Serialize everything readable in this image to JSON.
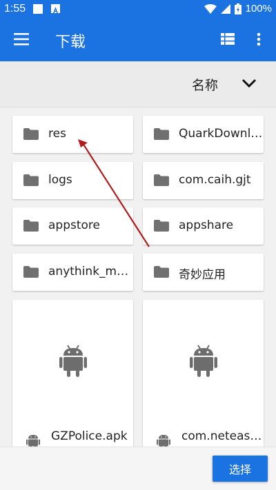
{
  "status_bar": {
    "time": "1:55",
    "battery": "100%"
  },
  "app_bar": {
    "title": "下载"
  },
  "sort": {
    "label": "名称"
  },
  "folders": [
    {
      "name": "res"
    },
    {
      "name": "QuarkDownl…"
    },
    {
      "name": "logs"
    },
    {
      "name": "com.caih.gjt"
    },
    {
      "name": "appstore"
    },
    {
      "name": "appshare"
    },
    {
      "name": "anythink_m…"
    },
    {
      "name": "奇妙应用"
    }
  ],
  "files": [
    {
      "name": "GZPolice.apk"
    },
    {
      "name": "com.neteas…"
    }
  ],
  "bottom_bar": {
    "select_label": "选择"
  },
  "colors": {
    "primary": "#1a73e0",
    "annotation_arrow": "#b01c1c"
  }
}
